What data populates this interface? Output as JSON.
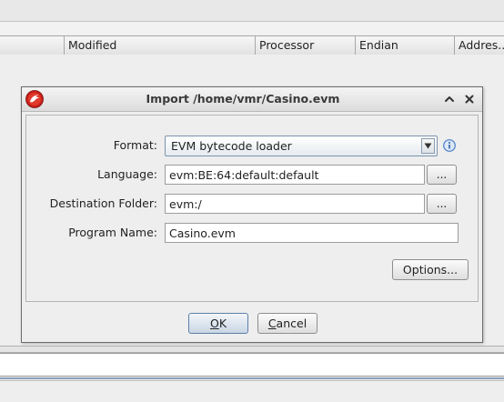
{
  "table": {
    "columns": [
      "",
      "Modified",
      "Processor",
      "Endian",
      "Addres..."
    ]
  },
  "dialog": {
    "title": "Import /home/vmr/Casino.evm",
    "format": {
      "label": "Format:",
      "value": "EVM bytecode loader"
    },
    "language": {
      "label": "Language:",
      "value": "evm:BE:64:default:default",
      "browse_label": "..."
    },
    "destination": {
      "label": "Destination Folder:",
      "value": "evm:/",
      "browse_label": "..."
    },
    "program_name": {
      "label": "Program Name:",
      "value": "Casino.evm"
    },
    "options_label": "Options...",
    "ok_mnemonic": "O",
    "ok_rest": "K",
    "cancel_mnemonic": "C",
    "cancel_rest": "ancel"
  },
  "icons": {
    "app": "ghidra-dragon-icon",
    "minimize": "chevron-up-icon",
    "close": "close-icon",
    "info": "info-icon",
    "dropdown": "triangle-down-icon"
  },
  "colors": {
    "app_icon_red": "#c8201a",
    "info_blue": "#4a7fc8",
    "ok_border": "#5d7fa6"
  }
}
